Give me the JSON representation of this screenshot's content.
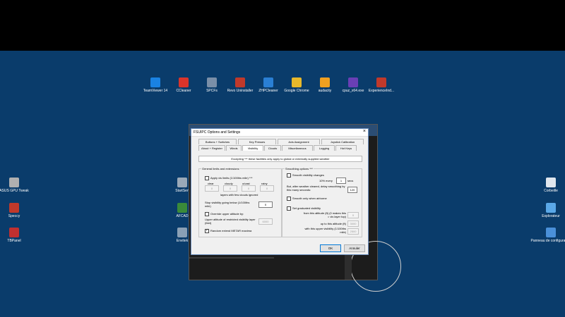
{
  "desktop": {
    "top_icons": [
      {
        "label": "TeamViewer 14",
        "icon": "teamviewer-icon",
        "color": "#1a82e2"
      },
      {
        "label": "CCleaner",
        "icon": "ccleaner-icon",
        "color": "#d9342b"
      },
      {
        "label": "SPCFs",
        "icon": "spcfs-icon",
        "color": "#7a8fa8"
      },
      {
        "label": "Revo Uninstaller",
        "icon": "revo-icon",
        "color": "#c0392b"
      },
      {
        "label": "ZHPCleaner",
        "icon": "zhpcleaner-icon",
        "color": "#2a7fd4"
      },
      {
        "label": "Google Chrome",
        "icon": "chrome-icon",
        "color": "#e8b82a"
      },
      {
        "label": "audacity",
        "icon": "audacity-icon",
        "color": "#f0a020"
      },
      {
        "label": "cpuz_x64.exe",
        "icon": "cpuz-icon",
        "color": "#6a3fb5"
      },
      {
        "label": "ExperienceInd...",
        "icon": "experience-icon",
        "color": "#c0392b"
      }
    ],
    "left_icons": [
      {
        "label": "ASUS GPU Tweak",
        "icon": "asus-gpu-icon",
        "color": "#b0b0b0"
      },
      {
        "label": "Speccy",
        "icon": "speccy-icon",
        "color": "#c0392b"
      },
      {
        "label": "TBPanel",
        "icon": "tbpanel-icon",
        "color": "#c03030"
      }
    ],
    "mid_icons": [
      {
        "label": "StartSen",
        "icon": "startsen-icon",
        "color": "#9aa9b8"
      },
      {
        "label": "AFCAD",
        "icon": "afcad-icon",
        "color": "#3a8a3a"
      },
      {
        "label": "Envitek",
        "icon": "envitek-icon",
        "color": "#8aa0b5"
      }
    ],
    "right_icons": [
      {
        "label": "Corbeille",
        "icon": "recycle-bin-icon",
        "color": "#dfe6ee"
      },
      {
        "label": "Explorateur",
        "icon": "explorer-icon",
        "color": "#5aa8e8"
      },
      {
        "label": "Panneau de configuration",
        "icon": "control-panel-icon",
        "color": "#4a90d9"
      }
    ]
  },
  "dialog": {
    "title": "FSUIPC Options and Settings",
    "tabs_back": [
      "Buttons + Switches",
      "Key Presses",
      "Axis Assignment",
      "Joystick Calibration"
    ],
    "tabs_front": [
      "About + Register",
      "Winds",
      "Visibility",
      "Clouds",
      "Miscellaneous",
      "Logging",
      "Hot Keys"
    ],
    "note": "Excepting *** these facilities only apply to global or externally supplied weather",
    "general": {
      "title": "General limits and extensions",
      "apply_vis": "Apply vis limits (1/100ths mile) ***",
      "cols": [
        "clear",
        "cloudy",
        "o/cast",
        "rainy"
      ],
      "vals": [
        "0",
        "0",
        "0",
        "0"
      ],
      "layers_note": "layers with few clouds ignored",
      "stop_vis": "Stop visibility going below (1/100ths mile)",
      "stop_val": "0",
      "override": "Override upper altitude by:",
      "upper_alt": "Upper altitude of restricted visibility layer (feet)",
      "upper_val": "6000",
      "random": "Random extend METAR maxima"
    },
    "smoothing": {
      "title": "Smoothing options ***",
      "smooth_changes": "Smooth visibility changes",
      "every_label": "10% every",
      "every_val": "1",
      "secs": "secs",
      "delay_label": "But, after weather cleared, delay smoothing by this many seconds:",
      "delay_val": "120",
      "airborne": "Smooth only when airborne",
      "graduated": "Set graduated visibility",
      "from_alt": "from this altitude (ft) (0 makes this = vis layer top)",
      "from_val": "0",
      "up_to": "up to this altitude (ft)",
      "up_to_val": "3000",
      "upper_vis": "with this upper visibility (1/100ths mile)",
      "upper_vis_val": "2500"
    },
    "ok": "OK",
    "cancel": "Annuler"
  }
}
